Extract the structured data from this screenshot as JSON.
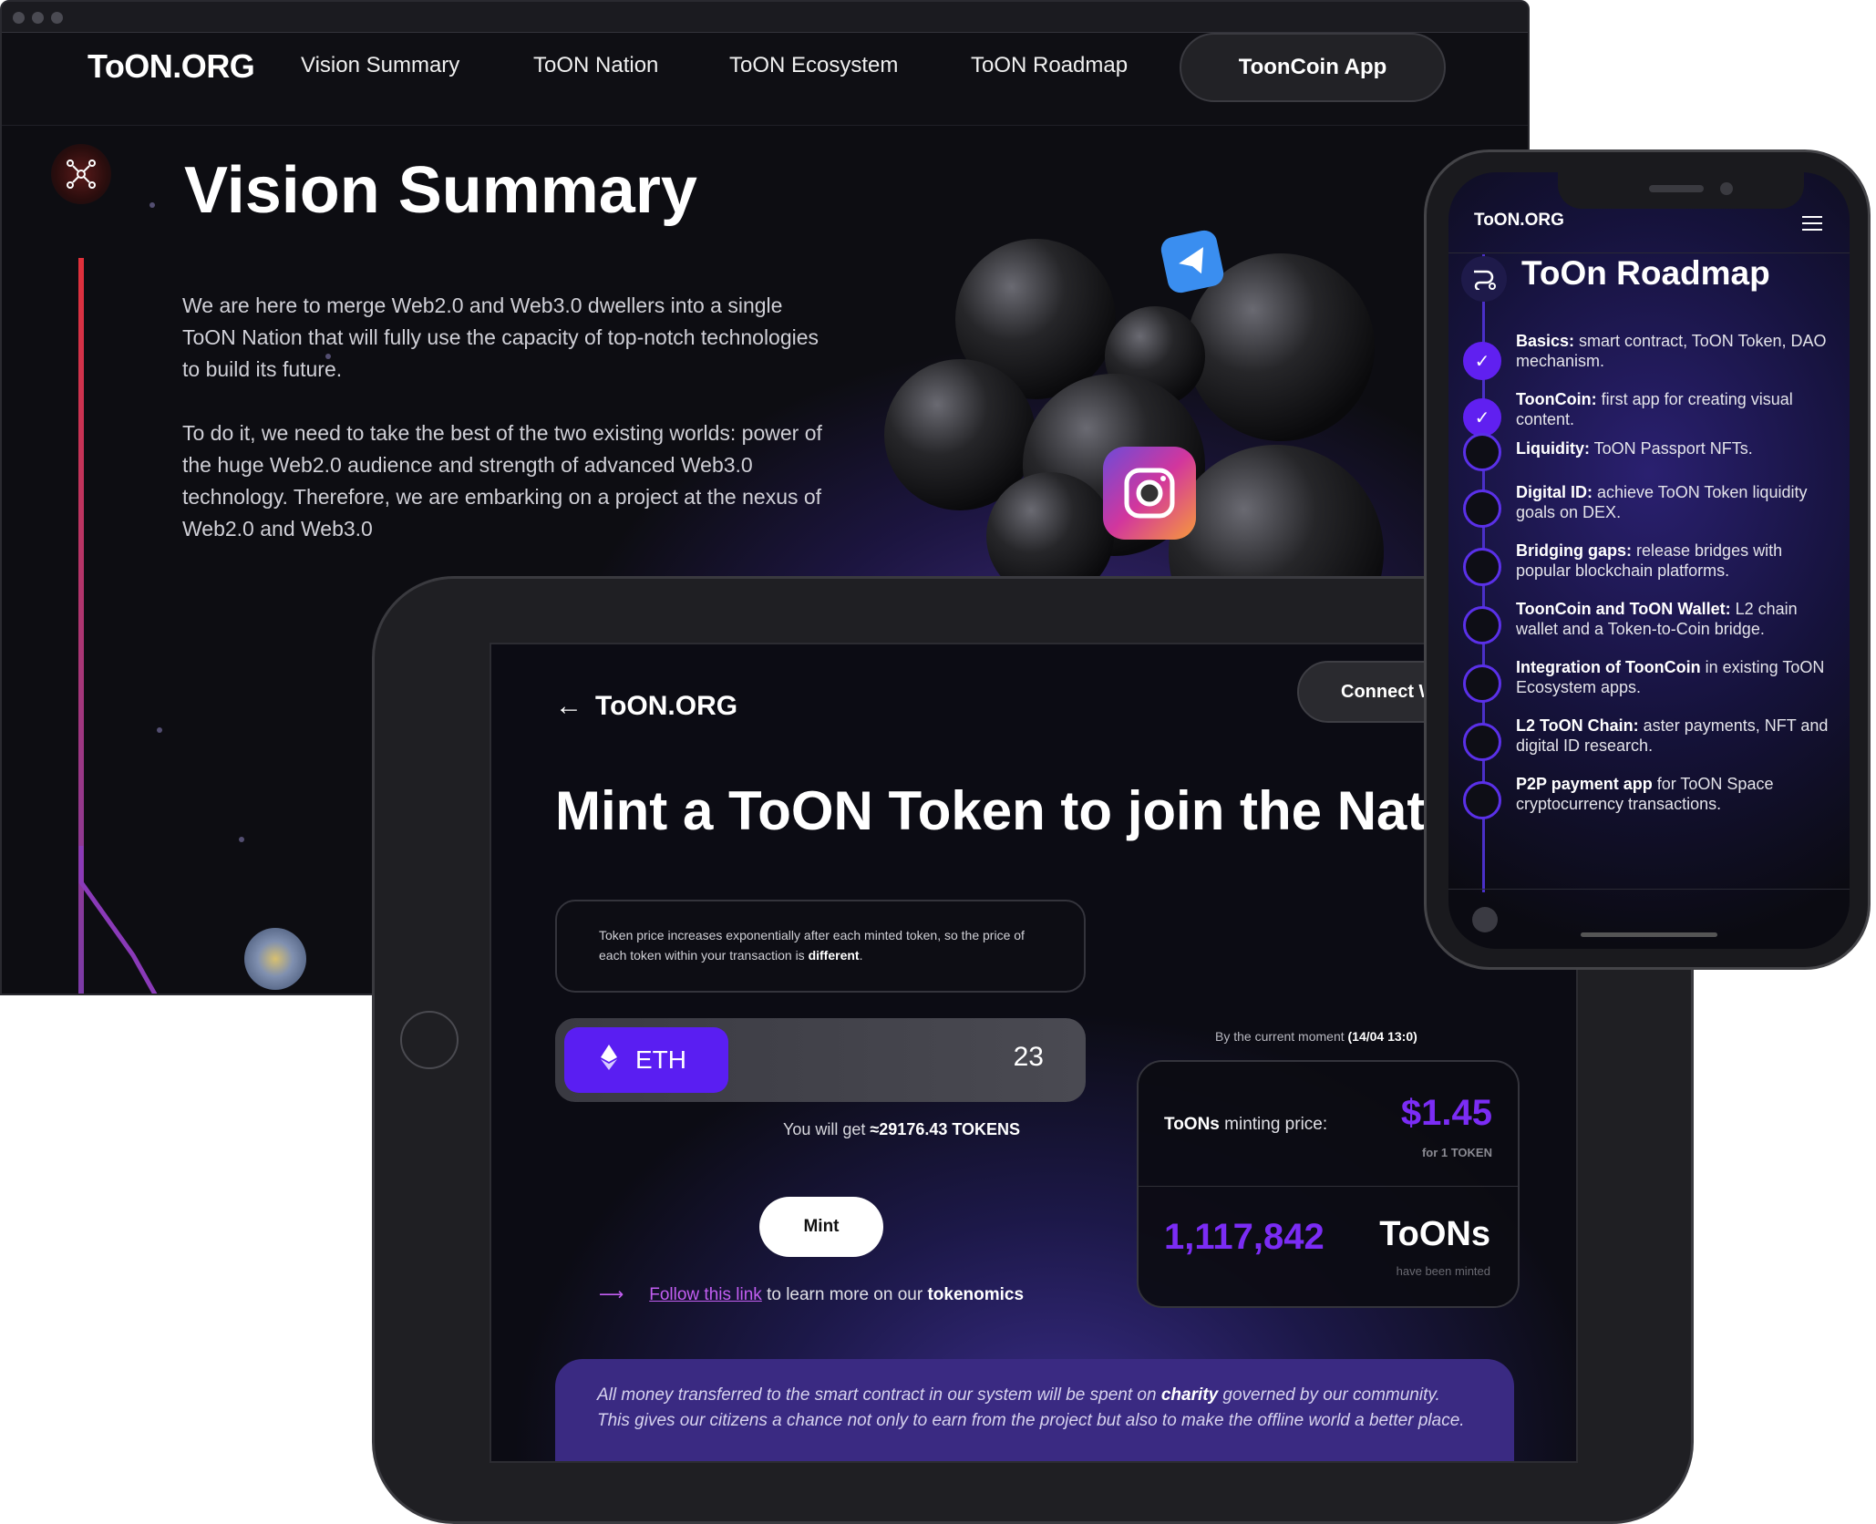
{
  "desktop": {
    "logo": "ToON.ORG",
    "nav": [
      "Vision Summary",
      "ToON Nation",
      "ToON Ecosystem",
      "ToON Roadmap"
    ],
    "app_button": "ToonCoin App",
    "hero_title": "Vision Summary",
    "paragraph1": "We are here to merge Web2.0 and Web3.0 dwellers into a single ToON Nation that will fully use the capacity of top-notch technologies to build its future.",
    "paragraph2": "To do it, we need to take the best of the two existing worlds: power of the huge Web2.0 audience and strength of advanced Web3.0 technology. Therefore, we are embarking on a project at the nexus of Web2.0 and Web3.0"
  },
  "tablet": {
    "logo": "ToON.ORG",
    "connect_button": "Connect W",
    "title": "Mint a ToON Token to join the Natio",
    "notice_text": "Token price increases exponentially after each minted token, so the price of each token within your transaction is ",
    "notice_bold": "different",
    "notice_end": ".",
    "currency": "ETH",
    "amount": "23",
    "get_prefix": "You will get ",
    "get_value": "≈29176.43 TOKENS",
    "mint_button": "Mint",
    "follow_link": "Follow this link",
    "follow_text": " to learn more on our ",
    "follow_bold": "tokenomics",
    "moment_prefix": "By the current moment ",
    "moment_value": "(14/04 13:0)",
    "price_label_bold": "ToONs",
    "price_label": " minting price:",
    "price_value": "$1.45",
    "price_per": "for 1 TOKEN",
    "minted_count": "1,117,842",
    "minted_unit": "ToONs",
    "minted_label": "have been minted",
    "charity_1": "All money transferred to the smart contract in our system will be spent on ",
    "charity_bold": "charity",
    "charity_2": " governed by our community. This gives our citizens a chance not only to earn from the project but also to make the offline world a better place."
  },
  "phone": {
    "logo": "ToON.ORG",
    "title": "ToOn Roadmap",
    "items": [
      {
        "bold": "Basics:",
        "text": " smart contract, ToON Token, DAO mechanism.",
        "done": true
      },
      {
        "bold": "ToonCoin:",
        "text": " first app for creating visual content.",
        "done": true
      },
      {
        "bold": "Liquidity:",
        "text": " ToON Passport NFTs.",
        "done": false
      },
      {
        "bold": "Digital ID:",
        "text": " achieve ToON Token liquidity goals on DEX.",
        "done": false
      },
      {
        "bold": "Bridging gaps:",
        "text": " release bridges with popular blockchain platforms.",
        "done": false
      },
      {
        "bold": "ToonCoin and ToON Wallet:",
        "text": " L2 chain wallet and a Token-to-Coin bridge.",
        "done": false
      },
      {
        "bold": "Integration of ToonCoin",
        "text": " in existing ToON Ecosystem apps.",
        "done": false
      },
      {
        "bold": "L2 ToON Chain:",
        "text": " aster payments, NFT and digital ID research.",
        "done": false
      },
      {
        "bold": "P2P payment app",
        "text": " for ToON Space cryptocurrency transactions.",
        "done": false
      }
    ]
  },
  "colors": {
    "accent": "#5a1ef2",
    "price": "#7b2cf5",
    "link": "#c35ef2",
    "line": "#e0303a"
  },
  "icons": [
    "network-icon",
    "back-arrow-icon",
    "ethereum-icon",
    "arrow-right-icon",
    "roadmap-icon",
    "check-icon",
    "menu-icon",
    "chart-icon",
    "instagram-icon",
    "telegram-icon"
  ]
}
